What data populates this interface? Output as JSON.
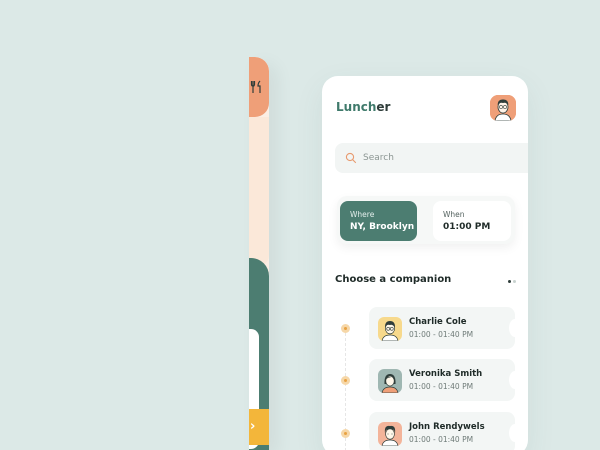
{
  "colors": {
    "background": "#dce9e7",
    "accent_green": "#4c7d71",
    "accent_orange": "#ef9f78",
    "accent_yellow": "#f3b63a",
    "cream": "#fbe8d9"
  },
  "left_screen": {
    "top_icon": "fork-knife-icon",
    "next_button_icon": "chevron-right-icon",
    "next_glyph": "›"
  },
  "header": {
    "logo_part1": "Lunch",
    "logo_part2": "er",
    "avatar_icon": "user-avatar-icon"
  },
  "search": {
    "placeholder": "Search",
    "value": "",
    "icon": "search-icon"
  },
  "selector": {
    "where_label": "Where",
    "where_value": "NY, Brooklyn",
    "when_label": "When",
    "when_value": "01:00 PM"
  },
  "companions": {
    "title": "Choose a companion",
    "page_indicator": {
      "count": 2,
      "active_index": 0
    },
    "items": [
      {
        "name": "Charlie Cole",
        "time": "01:00 - 01:40 PM",
        "avatar_color": "#f7d98c"
      },
      {
        "name": "Veronika Smith",
        "time": "01:00 - 01:40 PM",
        "avatar_color": "#9fb7b2"
      },
      {
        "name": "John Rendywels",
        "time": "01:00 - 01:40 PM",
        "avatar_color": "#f3b49a"
      }
    ]
  }
}
